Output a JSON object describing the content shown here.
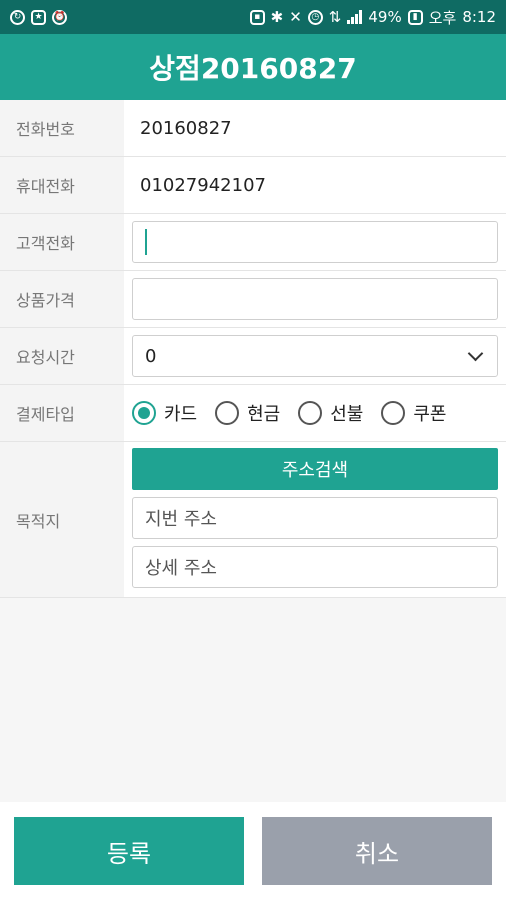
{
  "status_bar": {
    "battery": "49%",
    "ampm": "오후",
    "time": "8:12"
  },
  "header": {
    "title": "상점20160827"
  },
  "form": {
    "phone": {
      "label": "전화번호",
      "value": "20160827"
    },
    "mobile": {
      "label": "휴대전화",
      "value": "01027942107"
    },
    "customer_phone": {
      "label": "고객전화",
      "value": ""
    },
    "price": {
      "label": "상품가격",
      "value": ""
    },
    "request_time": {
      "label": "요청시간",
      "value": "0"
    },
    "payment": {
      "label": "결제타입",
      "options": [
        "카드",
        "현금",
        "선불",
        "쿠폰"
      ],
      "selected": "카드"
    },
    "destination": {
      "label": "목적지",
      "search_label": "주소검색",
      "lot_placeholder": "지번 주소",
      "detail_placeholder": "상세 주소"
    }
  },
  "actions": {
    "submit_label": "등록",
    "cancel_label": "취소"
  },
  "colors": {
    "primary": "#1fa392",
    "status_bar": "#0f6b63",
    "cancel": "#9aa0ab"
  }
}
